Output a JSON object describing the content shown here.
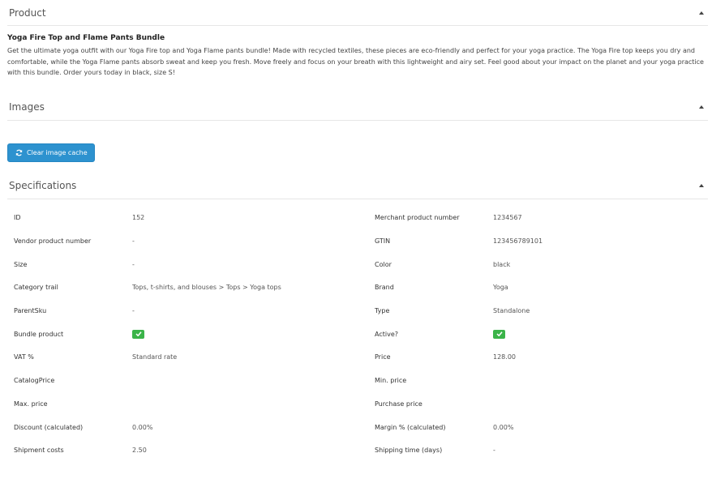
{
  "sections": {
    "product": {
      "title": "Product",
      "name": "Yoga Fire Top and Flame Pants Bundle",
      "description": "Get the ultimate yoga outfit with our Yoga Fire top and Yoga Flame pants bundle! Made with recycled textiles, these pieces are eco-friendly and perfect for your yoga practice. The Yoga Fire top keeps you dry and comfortable, while the Yoga Flame pants absorb sweat and keep you fresh. Move freely and focus on your breath with this lightweight and airy set. Feel good about your impact on the planet and your yoga practice with this bundle. Order yours today in black, size S!"
    },
    "images": {
      "title": "Images",
      "clear_cache_label": "Clear image cache"
    },
    "specifications": {
      "title": "Specifications",
      "rows": [
        {
          "left_label": "ID",
          "left_value": "152",
          "right_label": "Merchant product number",
          "right_value": "1234567"
        },
        {
          "left_label": "Vendor product number",
          "left_value": "-",
          "right_label": "GTIN",
          "right_value": "123456789101"
        },
        {
          "left_label": "Size",
          "left_value": "-",
          "right_label": "Color",
          "right_value": "black"
        },
        {
          "left_label": "Category trail",
          "left_value": "Tops, t-shirts, and blouses > Tops > Yoga tops",
          "right_label": "Brand",
          "right_value": "Yoga"
        },
        {
          "left_label": "ParentSku",
          "left_value": "-",
          "right_label": "Type",
          "right_value": "Standalone"
        },
        {
          "left_label": "Bundle product",
          "left_value": "",
          "right_label": "Active?",
          "right_value": ""
        },
        {
          "left_label": "VAT %",
          "left_value": "Standard rate",
          "right_label": "Price",
          "right_value": "128.00"
        },
        {
          "left_label": "CatalogPrice",
          "left_value": "",
          "right_label": "Min. price",
          "right_value": ""
        },
        {
          "left_label": "Max. price",
          "left_value": "",
          "right_label": "Purchase price",
          "right_value": ""
        },
        {
          "left_label": "Discount (calculated)",
          "left_value": "0.00%",
          "right_label": "Margin % (calculated)",
          "right_value": "0.00%"
        },
        {
          "left_label": "Shipment costs",
          "left_value": "2.50",
          "right_label": "Shipping time (days)",
          "right_value": "-"
        }
      ],
      "bundle_product": true,
      "active": true
    }
  },
  "icons": {
    "collapse": "caret-up-icon",
    "refresh": "refresh-icon",
    "check": "check-icon"
  },
  "colors": {
    "button_primary": "#2d92cf",
    "check_badge": "#3bb449"
  }
}
